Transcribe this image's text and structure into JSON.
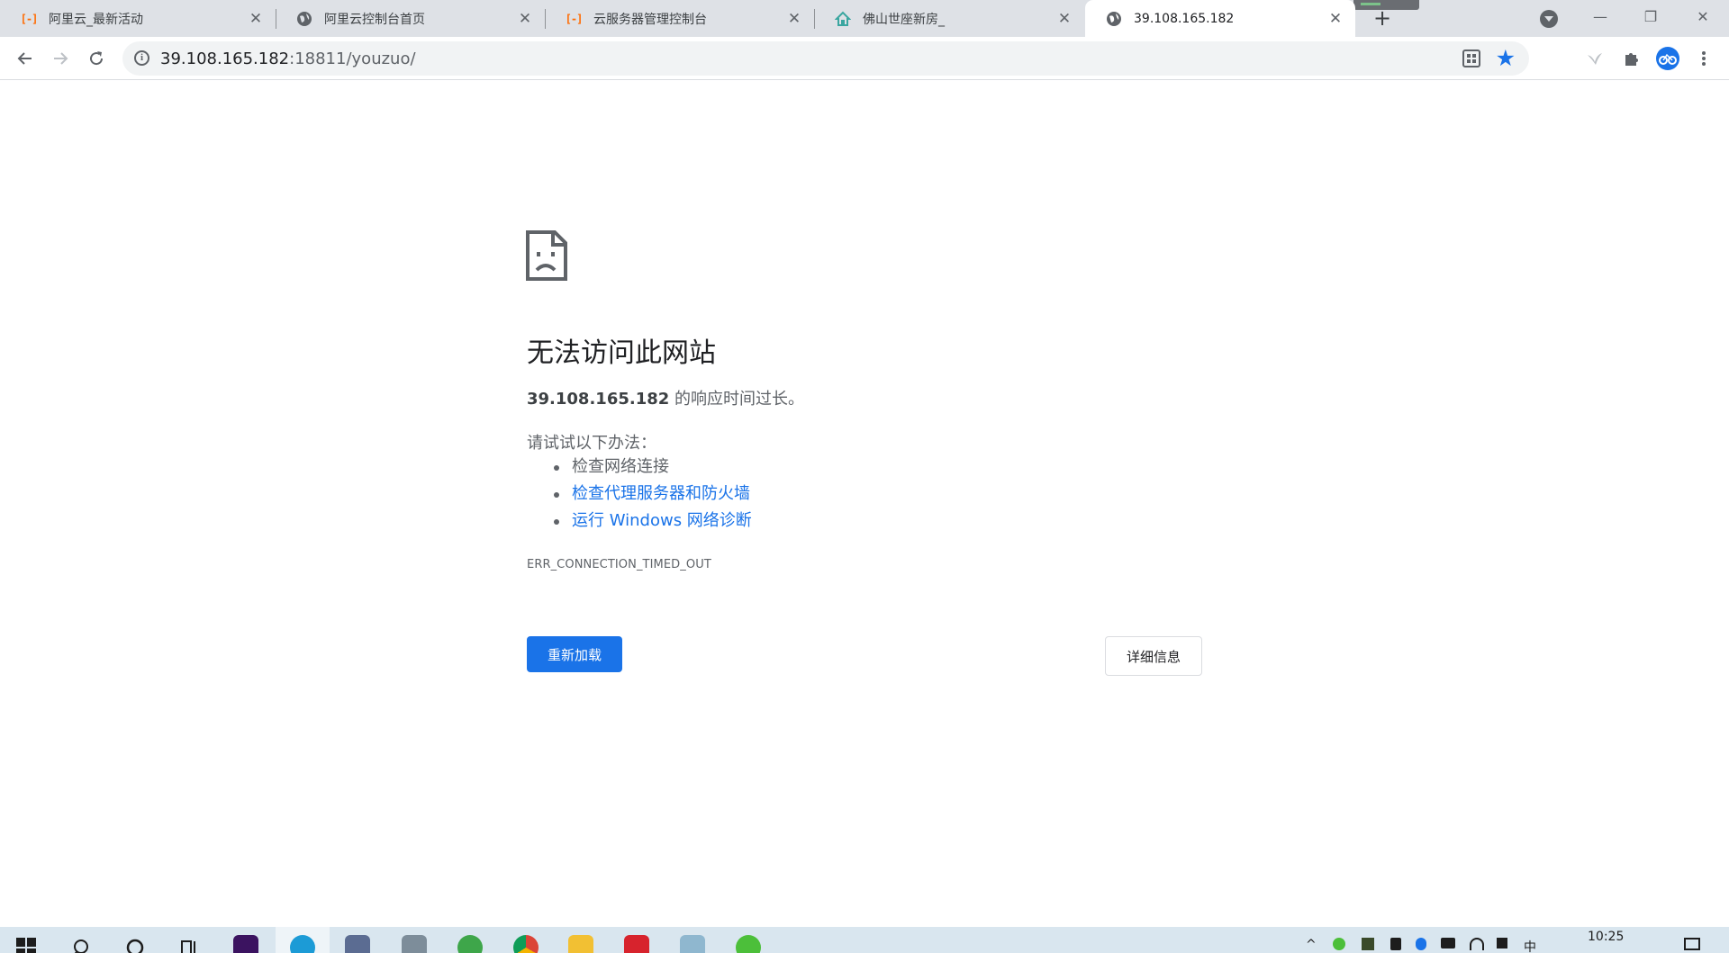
{
  "browser": {
    "tabs": [
      {
        "title": "阿里云_最新活动",
        "favicon": "aliyun-icon",
        "active": false
      },
      {
        "title": "阿里云控制台首页",
        "favicon": "globe-icon",
        "active": false
      },
      {
        "title": "云服务器管理控制台",
        "favicon": "aliyun-icon",
        "active": false
      },
      {
        "title": "佛山世座新房_",
        "favicon": "house-icon",
        "active": false
      },
      {
        "title": "39.108.165.182",
        "favicon": "globe-icon",
        "active": true
      }
    ],
    "close_glyph": "✕",
    "newtab_glyph": "+",
    "window": {
      "minimize": "—",
      "restore": "❐",
      "close": "✕"
    },
    "address": {
      "host": "39.108.165.182",
      "rest": ":18811/youzuo/"
    },
    "accent": "#1a73e8"
  },
  "error_page": {
    "heading": "无法访问此网站",
    "summary_host": "39.108.165.182",
    "summary_text": " 的响应时间过长。",
    "try_heading": "请试试以下办法：",
    "suggestions": [
      {
        "text": "检查网络连接",
        "link": false
      },
      {
        "text": "检查代理服务器和防火墙",
        "link": true
      },
      {
        "text": "运行 Windows 网络诊断",
        "link": true
      }
    ],
    "error_code": "ERR_CONNECTION_TIMED_OUT",
    "reload_label": "重新加载",
    "details_label": "详细信息"
  },
  "taskbar": {
    "clock": "10:25",
    "ime": "中",
    "apps": [
      "windows-start-icon",
      "search-icon",
      "cortana-icon",
      "task-view-icon",
      "photoshop-icon",
      "edge-icon",
      "security-icon",
      "photos-icon",
      "frog-app-icon",
      "chrome-icon",
      "file-explorer-icon",
      "netease-music-icon",
      "notepad-icon",
      "wechat-icon"
    ]
  }
}
